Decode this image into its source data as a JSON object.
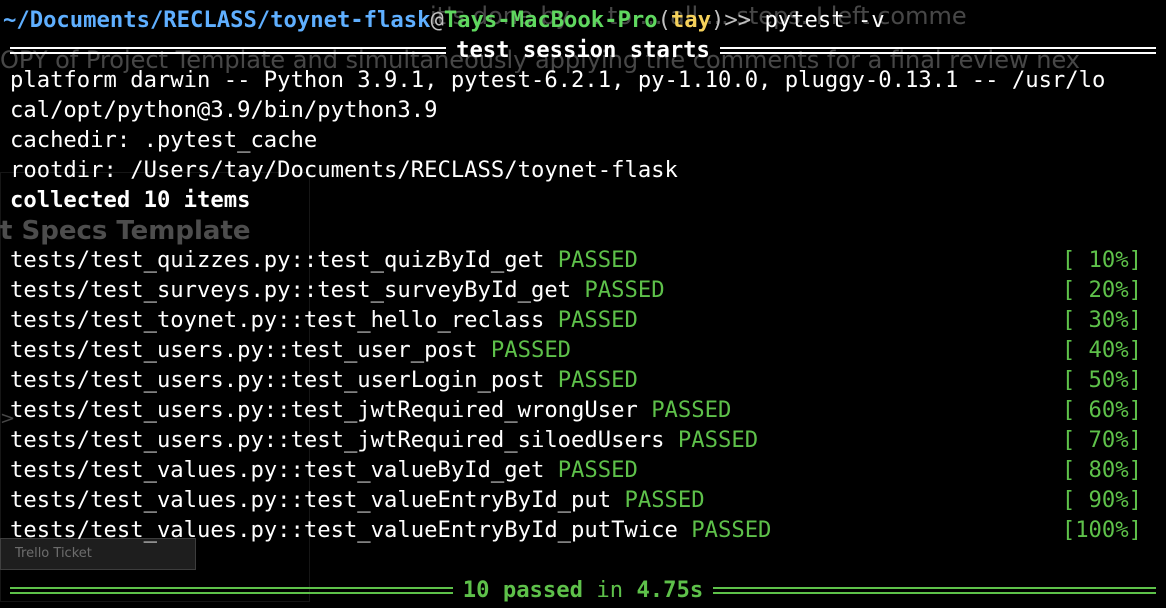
{
  "prompt": {
    "path": "~/Documents/RECLASS/toynet-flask",
    "at": "@",
    "host": "Tays-MacBook-Pro",
    "paren_open": "(",
    "user": "tay",
    "paren_close": ")",
    "gt": ">>",
    "command": "pytest -v"
  },
  "background_doc": {
    "line1": "it's done by ... to ... all ... steps. I left comme",
    "line2": "OPY of Project Template and simultaneously applying the comments for a final review nex",
    "line3": "t Specs Template",
    "line4": ">",
    "trello": "Trello Ticket"
  },
  "session": {
    "header": "test session starts",
    "platform_line1": "platform darwin -- Python 3.9.1, pytest-6.2.1, py-1.10.0, pluggy-0.13.1 -- /usr/lo",
    "platform_line2": "cal/opt/python@3.9/bin/python3.9",
    "cachedir": "cachedir: .pytest_cache",
    "rootdir": "rootdir: /Users/tay/Documents/RECLASS/toynet-flask",
    "collected": "collected 10 items"
  },
  "tests": [
    {
      "name": "tests/test_quizzes.py::test_quizById_get",
      "status": "PASSED",
      "pct": "[ 10%]"
    },
    {
      "name": "tests/test_surveys.py::test_surveyById_get",
      "status": "PASSED",
      "pct": "[ 20%]"
    },
    {
      "name": "tests/test_toynet.py::test_hello_reclass",
      "status": "PASSED",
      "pct": "[ 30%]"
    },
    {
      "name": "tests/test_users.py::test_user_post",
      "status": "PASSED",
      "pct": "[ 40%]"
    },
    {
      "name": "tests/test_users.py::test_userLogin_post",
      "status": "PASSED",
      "pct": "[ 50%]"
    },
    {
      "name": "tests/test_users.py::test_jwtRequired_wrongUser",
      "status": "PASSED",
      "pct": "[ 60%]"
    },
    {
      "name": "tests/test_users.py::test_jwtRequired_siloedUsers",
      "status": "PASSED",
      "pct": "[ 70%]"
    },
    {
      "name": "tests/test_values.py::test_valueById_get",
      "status": "PASSED",
      "pct": "[ 80%]"
    },
    {
      "name": "tests/test_values.py::test_valueEntryById_put",
      "status": "PASSED",
      "pct": "[ 90%]"
    },
    {
      "name": "tests/test_values.py::test_valueEntryById_putTwice",
      "status": "PASSED",
      "pct": "[100%]"
    }
  ],
  "summary": {
    "passed": "10 passed",
    "in": " in ",
    "duration": "4.75s"
  },
  "colors": {
    "background": "#000000",
    "path": "#5fafff",
    "host": "#5fd75f",
    "user": "#f5d15b",
    "passed": "#5ec14a"
  }
}
